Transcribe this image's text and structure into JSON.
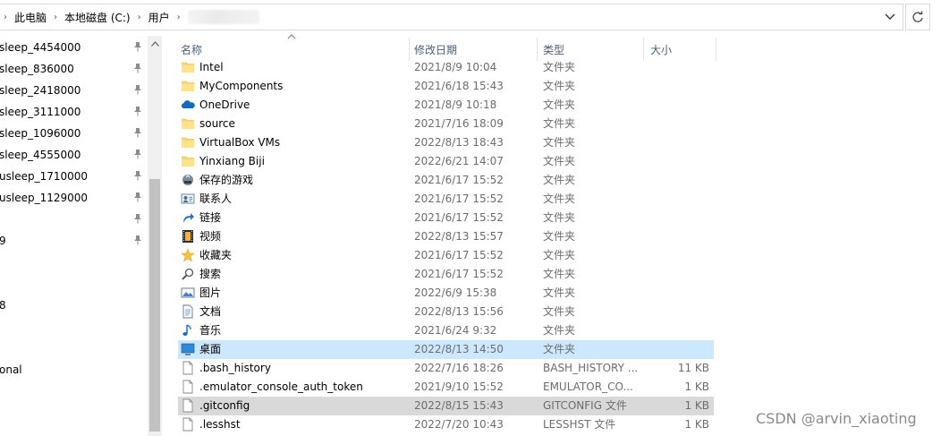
{
  "breadcrumb": {
    "items": [
      "此电脑",
      "本地磁盘 (C:)",
      "用户"
    ]
  },
  "nav": {
    "items": [
      {
        "label": "sleep_4454000",
        "pinned": true
      },
      {
        "label": "sleep_836000",
        "pinned": true
      },
      {
        "label": "sleep_2418000",
        "pinned": true
      },
      {
        "label": "sleep_3111000",
        "pinned": true
      },
      {
        "label": "sleep_1096000",
        "pinned": true
      },
      {
        "label": "sleep_4555000",
        "pinned": true
      },
      {
        "label": "usleep_1710000",
        "pinned": true
      },
      {
        "label": "usleep_1129000",
        "pinned": true
      },
      {
        "label": "",
        "pinned": true
      },
      {
        "label": "9",
        "pinned": true
      },
      {
        "label": "",
        "pinned": false
      },
      {
        "label": "",
        "pinned": false
      },
      {
        "label": "8",
        "pinned": false
      },
      {
        "label": "",
        "pinned": false
      },
      {
        "label": "",
        "pinned": false
      },
      {
        "label": "onal",
        "pinned": false
      }
    ]
  },
  "columns": {
    "name": "名称",
    "date": "修改日期",
    "type": "类型",
    "size": "大小"
  },
  "files": [
    {
      "name": "Intel",
      "date": "2021/8/9 10:04",
      "type": "文件夹",
      "size": "",
      "icon": "folder-icon",
      "state": ""
    },
    {
      "name": "MyComponents",
      "date": "2021/6/18 15:43",
      "type": "文件夹",
      "size": "",
      "icon": "folder-icon",
      "state": ""
    },
    {
      "name": "OneDrive",
      "date": "2021/8/9 10:18",
      "type": "文件夹",
      "size": "",
      "icon": "onedrive-icon",
      "state": ""
    },
    {
      "name": "source",
      "date": "2021/7/16 18:09",
      "type": "文件夹",
      "size": "",
      "icon": "folder-icon",
      "state": ""
    },
    {
      "name": "VirtualBox VMs",
      "date": "2022/8/13 18:43",
      "type": "文件夹",
      "size": "",
      "icon": "folder-icon",
      "state": ""
    },
    {
      "name": "Yinxiang Biji",
      "date": "2022/6/21 14:07",
      "type": "文件夹",
      "size": "",
      "icon": "folder-icon",
      "state": ""
    },
    {
      "name": "保存的游戏",
      "date": "2021/6/17 15:52",
      "type": "文件夹",
      "size": "",
      "icon": "saved-games-icon",
      "state": ""
    },
    {
      "name": "联系人",
      "date": "2021/6/17 15:52",
      "type": "文件夹",
      "size": "",
      "icon": "contacts-icon",
      "state": ""
    },
    {
      "name": "链接",
      "date": "2021/6/17 15:52",
      "type": "文件夹",
      "size": "",
      "icon": "links-icon",
      "state": ""
    },
    {
      "name": "视频",
      "date": "2022/8/13 15:57",
      "type": "文件夹",
      "size": "",
      "icon": "videos-icon",
      "state": ""
    },
    {
      "name": "收藏夹",
      "date": "2021/6/17 15:52",
      "type": "文件夹",
      "size": "",
      "icon": "favorites-icon",
      "state": ""
    },
    {
      "name": "搜索",
      "date": "2021/6/17 15:52",
      "type": "文件夹",
      "size": "",
      "icon": "searches-icon",
      "state": ""
    },
    {
      "name": "图片",
      "date": "2022/6/9 15:38",
      "type": "文件夹",
      "size": "",
      "icon": "pictures-icon",
      "state": ""
    },
    {
      "name": "文档",
      "date": "2022/8/13 15:56",
      "type": "文件夹",
      "size": "",
      "icon": "documents-icon",
      "state": ""
    },
    {
      "name": "音乐",
      "date": "2021/6/24 9:32",
      "type": "文件夹",
      "size": "",
      "icon": "music-icon",
      "state": ""
    },
    {
      "name": "桌面",
      "date": "2022/8/13 14:50",
      "type": "文件夹",
      "size": "",
      "icon": "desktop-icon",
      "state": "selected"
    },
    {
      "name": ".bash_history",
      "date": "2022/7/16 18:26",
      "type": "BASH_HISTORY ...",
      "size": "11 KB",
      "icon": "file-icon",
      "state": ""
    },
    {
      "name": ".emulator_console_auth_token",
      "date": "2021/9/10 15:52",
      "type": "EMULATOR_CO...",
      "size": "1 KB",
      "icon": "file-icon",
      "state": ""
    },
    {
      "name": ".gitconfig",
      "date": "2022/8/15 15:43",
      "type": "GITCONFIG 文件",
      "size": "1 KB",
      "icon": "file-icon",
      "state": "hover"
    },
    {
      "name": ".lesshst",
      "date": "2022/7/20 10:43",
      "type": "LESSHST 文件",
      "size": "1 KB",
      "icon": "file-icon",
      "state": ""
    }
  ],
  "watermark": "CSDN @arvin_xiaoting",
  "colors": {
    "selected": "#cce8ff",
    "hover": "#d9d9d9",
    "folder": "#ffd766",
    "header_text": "#4c607a"
  }
}
